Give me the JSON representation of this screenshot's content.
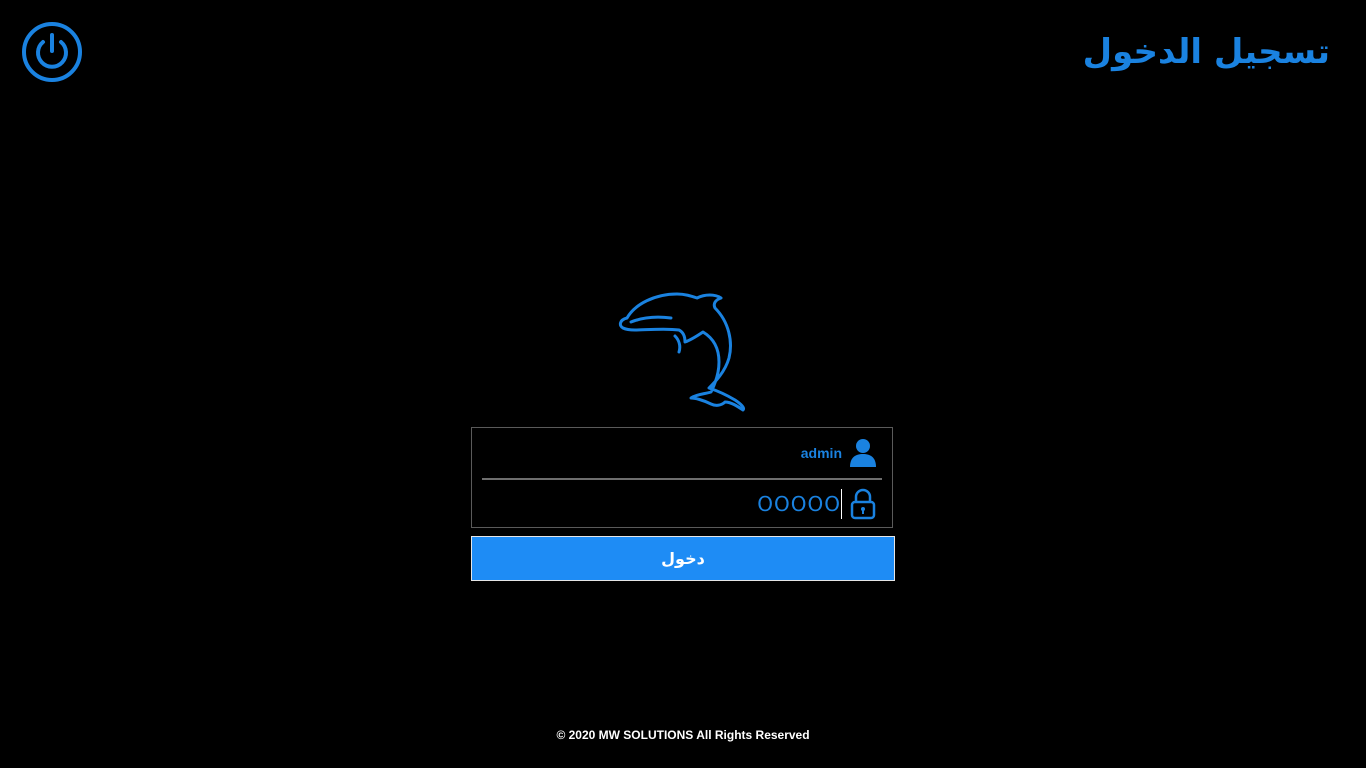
{
  "header": {
    "title": "تسجيل الدخول",
    "power_icon": "power-icon"
  },
  "login": {
    "username_value": "admin",
    "username_icon": "user-icon",
    "password_mask": "OOOOO",
    "password_icon": "lock-icon",
    "submit_label": "دخول"
  },
  "brand": {
    "logo_icon": "dolphin-icon"
  },
  "footer": {
    "copyright": "© 2020 MW SOLUTIONS All Rights Reserved"
  },
  "colors": {
    "background": "#000000",
    "accent": "#1a82e0",
    "button": "#1e8cf5",
    "text": "#ffffff"
  }
}
